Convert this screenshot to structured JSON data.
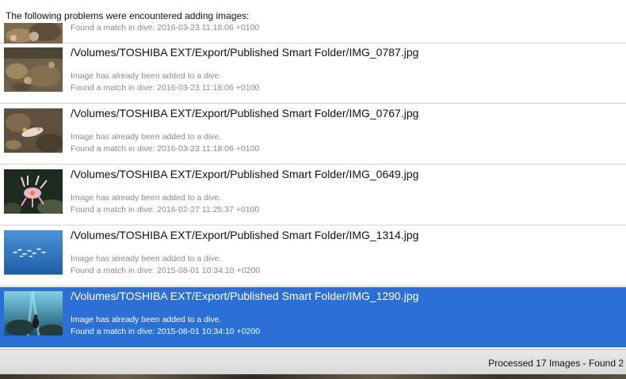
{
  "header": {
    "text": "The following problems were encountered adding images:"
  },
  "rows": [
    {
      "path": "",
      "msg1": "",
      "msg2": "Found a match in dive: 2016-03-23 11:18:06 +0100",
      "thumbnail": "reef-photo-icon"
    },
    {
      "path": "/Volumes/TOSHIBA EXT/Export/Published Smart Folder/IMG_0787.jpg",
      "msg1": "Image has already been added to a dive.",
      "msg2": "Found a match in dive: 2016-03-23 11:18:06 +0100",
      "thumbnail": "reef-photo-icon"
    },
    {
      "path": "/Volumes/TOSHIBA EXT/Export/Published Smart Folder/IMG_0767.jpg",
      "msg1": "Image has already been added to a dive.",
      "msg2": "Found a match in dive: 2016-03-23 11:18:06 +0100",
      "thumbnail": "nudibranch-photo-icon"
    },
    {
      "path": "/Volumes/TOSHIBA EXT/Export/Published Smart Folder/IMG_0649.jpg",
      "msg1": "Image has already been added to a dive.",
      "msg2": "Found a match in dive: 2016-02-27 11:25:37 +0100",
      "thumbnail": "nudibranch-photo-icon"
    },
    {
      "path": "/Volumes/TOSHIBA EXT/Export/Published Smart Folder/IMG_1314.jpg",
      "msg1": "Image has already been added to a dive.",
      "msg2": "Found a match in dive: 2015-08-01 10:34:10 +0200",
      "thumbnail": "fish-school-photo-icon"
    },
    {
      "path": "/Volumes/TOSHIBA EXT/Export/Published Smart Folder/IMG_1290.jpg",
      "msg1": "Image has already been added to a dive.",
      "msg2": "Found a match in dive: 2015-08-01 10:34:10 +0200",
      "thumbnail": "diver-photo-icon",
      "selected": true
    }
  ],
  "status": {
    "text": "Processed 17 Images - Found 2"
  },
  "colors": {
    "selection": "#2a70d6",
    "muted_text": "#8a8a8a",
    "divider": "#d4d4d4"
  }
}
